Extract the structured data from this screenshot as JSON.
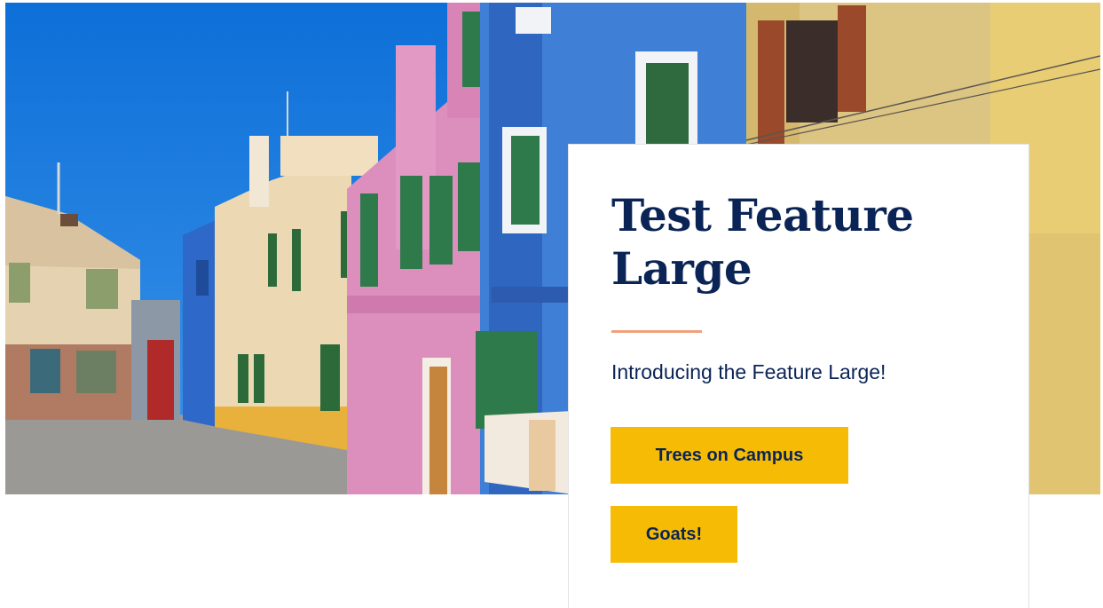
{
  "feature": {
    "title": "Test Feature Large",
    "subtitle": "Introducing the Feature Large!",
    "buttons": [
      {
        "label": "Trees on Campus"
      },
      {
        "label": "Goats!"
      }
    ]
  },
  "colors": {
    "heading": "#0b2456",
    "accent_rule": "#f0a17c",
    "button_bg": "#f6bc05",
    "card_bg": "#ffffff"
  }
}
